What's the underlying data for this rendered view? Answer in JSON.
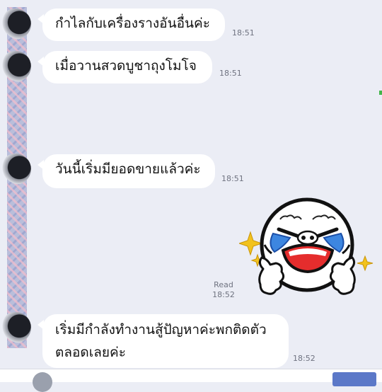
{
  "messages": [
    {
      "text": "กำไลกับเครื่องรางอันอื่นค่ะ",
      "time": "18:51"
    },
    {
      "text": "เมื่อวานสวดบูชาถุงโมโจ",
      "time": "18:51"
    },
    {
      "text": "วันนี้เริ่มมียอดขายแล้วค่ะ",
      "time": "18:51"
    },
    {
      "line1": "เริ่มมีกำลังทำงานสู้ปัญหาค่ะพกติดตัว",
      "line2": "ตลอดเลยค่ะ",
      "time": "18:52"
    }
  ],
  "sent": {
    "read_label": "Read",
    "time": "18:52",
    "sticker": "crying-laughing-thumbs-up-sticker"
  },
  "colors": {
    "background": "#ebedf5",
    "bubble": "#ffffff",
    "time": "#6f7380"
  }
}
